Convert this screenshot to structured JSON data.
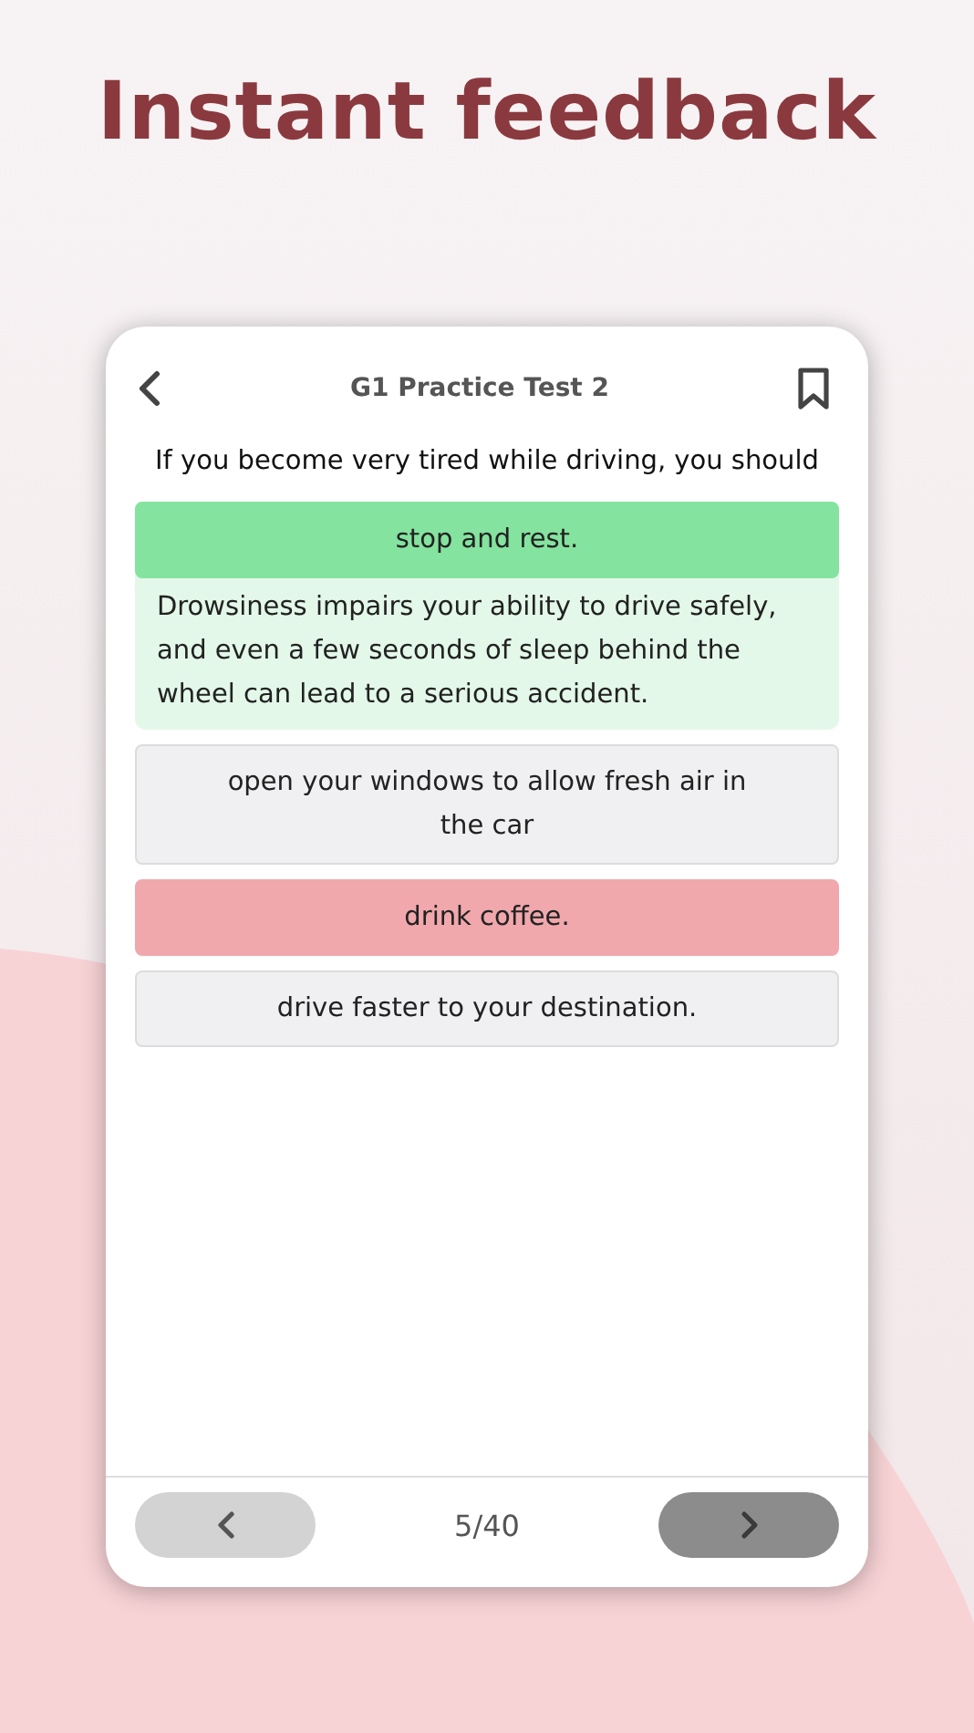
{
  "headline": "Instant feedback",
  "header": {
    "title": "G1 Practice Test 2",
    "bookmarked": false
  },
  "question": "If you become very tired while driving, you should",
  "options": [
    {
      "text": "stop and rest.",
      "kind": "correct",
      "explanation": "Drowsiness impairs your ability to drive safely, and even a few seconds of sleep behind the wheel can lead to a serious accident."
    },
    {
      "text": "open your windows to allow fresh air in the car",
      "kind": "plain"
    },
    {
      "text": "drink coffee.",
      "kind": "wrong"
    },
    {
      "text": "drive faster to your destination.",
      "kind": "plain"
    }
  ],
  "footer": {
    "counter": "5/40",
    "prev_disabled": true,
    "next_disabled": false
  }
}
